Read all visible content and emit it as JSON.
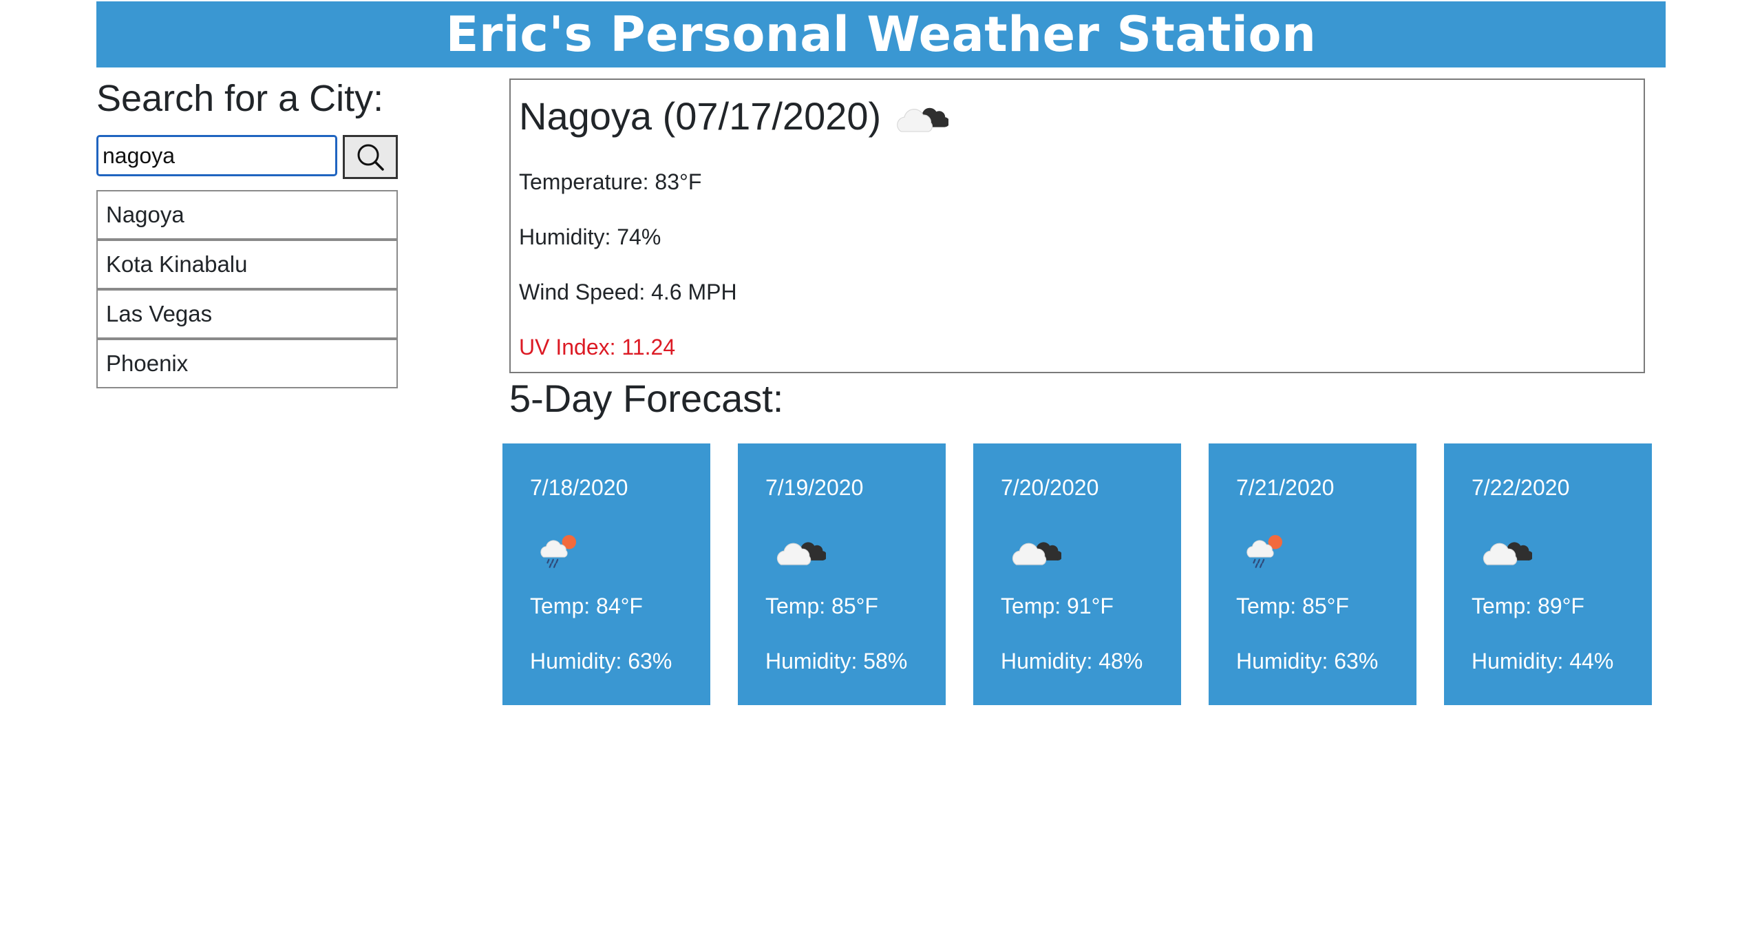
{
  "header": {
    "title": "Eric's Personal Weather Station"
  },
  "search": {
    "title": "Search for a City:",
    "input_value": "nagoya",
    "button_icon": "search-icon"
  },
  "cities": [
    {
      "label": "Nagoya"
    },
    {
      "label": "Kota Kinabalu"
    },
    {
      "label": "Las Vegas"
    },
    {
      "label": "Phoenix"
    }
  ],
  "current": {
    "title": "Nagoya (07/17/2020)",
    "icon": "broken-clouds-icon",
    "temperature": "Temperature: 83°F",
    "humidity": "Humidity: 74%",
    "wind": "Wind Speed: 4.6 MPH",
    "uv": "UV Index: 11.24",
    "uv_color": "#dc1a24"
  },
  "forecast": {
    "title": "5-Day Forecast:",
    "accent_color": "#3a97d2",
    "days": [
      {
        "date": "7/18/2020",
        "icon": "rain-icon",
        "temp": "Temp: 84°F",
        "humidity": "Humidity: 63%"
      },
      {
        "date": "7/19/2020",
        "icon": "broken-clouds-icon",
        "temp": "Temp: 85°F",
        "humidity": "Humidity: 58%"
      },
      {
        "date": "7/20/2020",
        "icon": "broken-clouds-icon",
        "temp": "Temp: 91°F",
        "humidity": "Humidity: 48%"
      },
      {
        "date": "7/21/2020",
        "icon": "rain-icon",
        "temp": "Temp: 85°F",
        "humidity": "Humidity: 63%"
      },
      {
        "date": "7/22/2020",
        "icon": "broken-clouds-icon",
        "temp": "Temp: 89°F",
        "humidity": "Humidity: 44%"
      }
    ]
  }
}
